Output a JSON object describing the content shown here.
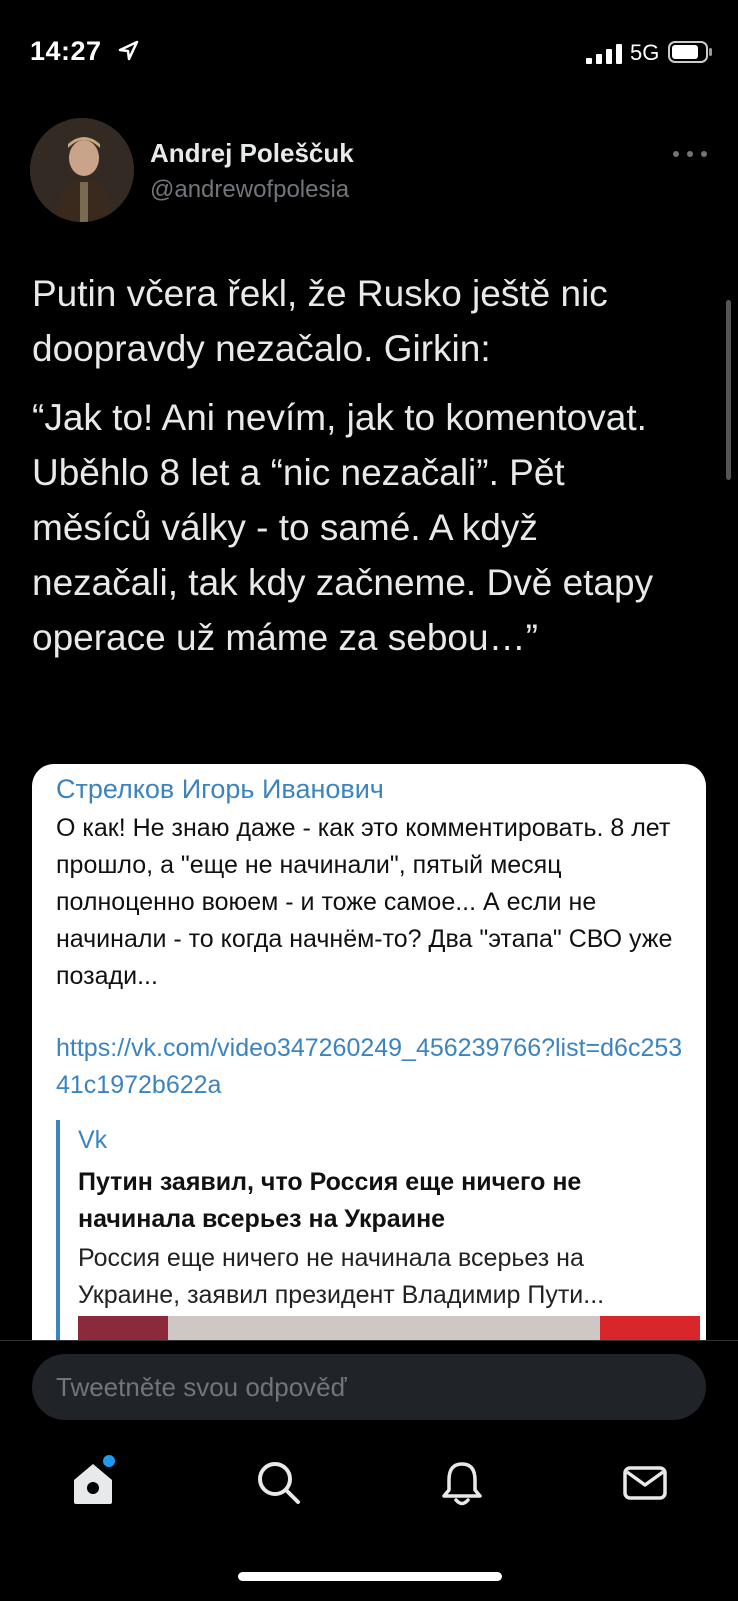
{
  "status_bar": {
    "time": "14:27",
    "network": "5G"
  },
  "author": {
    "name": "Andrej Poleščuk",
    "handle": "@andrewofpolesia"
  },
  "tweet": {
    "paragraph_1": "Putin včera řekl, že Rusko ještě nic doopravdy nezačalo. Girkin:",
    "paragraph_2": "“Jak to! Ani nevím, jak to komentovat. Uběhlo 8 let a “nic nezačali”. Pět měsíců války - to samé. A když nezačali, tak kdy začneme. Dvě etapy operace už máme za sebou…”"
  },
  "quoted_image": {
    "author": "Стрелков Игорь Иванович",
    "message": "О как! Не знаю даже - как это комментировать. 8 лет прошло, а \"еще не начинали\", пятый месяц полноценно воюем - и тоже самое... А если не начинали - то когда начнём-то? Два \"этапа\" СВО уже позади...",
    "link": "https://vk.com/video347260249_456239766?list=d6c25341c1972b622a",
    "preview": {
      "site": "Vk",
      "title": "Путин заявил, что Россия еще ничего не начинала всерьез на Украине",
      "description": "Россия еще ничего не начинала всерьез на Украине, заявил президент Владимир Пути..."
    }
  },
  "reply": {
    "placeholder": "Tweetněte svou odpověď"
  },
  "nav": {
    "icons": [
      "home-icon",
      "search-icon",
      "bell-icon",
      "mail-icon"
    ],
    "accent": "#1d9bf0"
  },
  "colors": {
    "background": "#000000",
    "text": "#e7e9ea",
    "secondary": "#71767b",
    "telegram_blue": "#3c84c0"
  }
}
